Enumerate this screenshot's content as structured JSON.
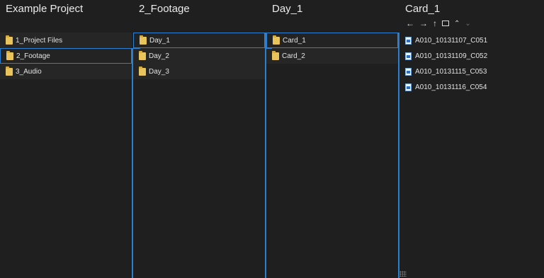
{
  "colors": {
    "selection_border": "#2a7fd0",
    "background": "#1f1f1f",
    "folder": "#e9c45c"
  },
  "columns": [
    {
      "title": "Example Project",
      "items": [
        {
          "label": "1_Project Files",
          "icon": "folder-icon"
        },
        {
          "label": "2_Footage",
          "icon": "folder-icon",
          "selected": true
        },
        {
          "label": "3_Audio",
          "icon": "folder-icon"
        }
      ]
    },
    {
      "title": "2_Footage",
      "items": [
        {
          "label": "Day_1",
          "icon": "folder-icon",
          "selected": true
        },
        {
          "label": "Day_2",
          "icon": "folder-icon"
        },
        {
          "label": "Day_3",
          "icon": "folder-icon"
        }
      ]
    },
    {
      "title": "Day_1",
      "items": [
        {
          "label": "Card_1",
          "icon": "folder-icon",
          "selected": true
        },
        {
          "label": "Card_2",
          "icon": "folder-icon"
        }
      ]
    },
    {
      "title": "Card_1",
      "toolbar": [
        "back-arrow-icon",
        "forward-arrow-icon",
        "up-arrow-icon",
        "folder-view-icon",
        "chevron-up-icon",
        "chevron-down-icon"
      ],
      "items": [
        {
          "label": "A010_10131107_C051",
          "icon": "file-icon"
        },
        {
          "label": "A010_10131109_C052",
          "icon": "file-icon"
        },
        {
          "label": "A010_10131115_C053",
          "icon": "file-icon"
        },
        {
          "label": "A010_10131116_C054",
          "icon": "file-icon"
        }
      ]
    }
  ]
}
